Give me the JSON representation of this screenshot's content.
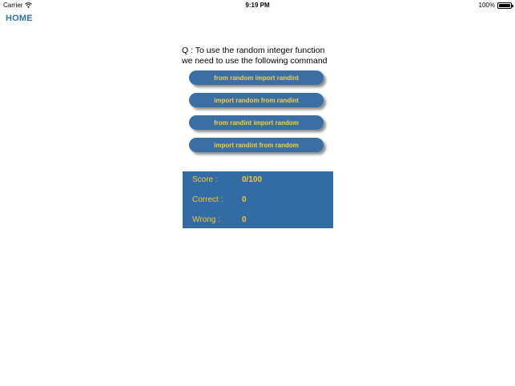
{
  "status_bar": {
    "carrier": "Carrier",
    "time": "9:19 PM",
    "battery": "100%",
    "battery_level": 1.0,
    "wifi_icon": "wifi-icon",
    "battery_icon": "battery-icon"
  },
  "nav": {
    "home_label": "HOME"
  },
  "question": {
    "line1": "Q : To use the random integer function",
    "line2": "we need to use the following command"
  },
  "answers": [
    {
      "label": "from random import randint"
    },
    {
      "label": "import random from randint"
    },
    {
      "label": "from randint import random"
    },
    {
      "label": "import randint from random"
    }
  ],
  "scoreboard": {
    "score_label": "Score :",
    "score_value": "0/100",
    "correct_label": "Correct :",
    "correct_value": "0",
    "wrong_label": "Wrong :",
    "wrong_value": "0"
  },
  "colors": {
    "accent": "#2f6fb0",
    "button_bg": "#3b6fa3",
    "button_text": "#f5d23c",
    "panel_bg": "#336ca3",
    "panel_text": "#f2ca33"
  }
}
